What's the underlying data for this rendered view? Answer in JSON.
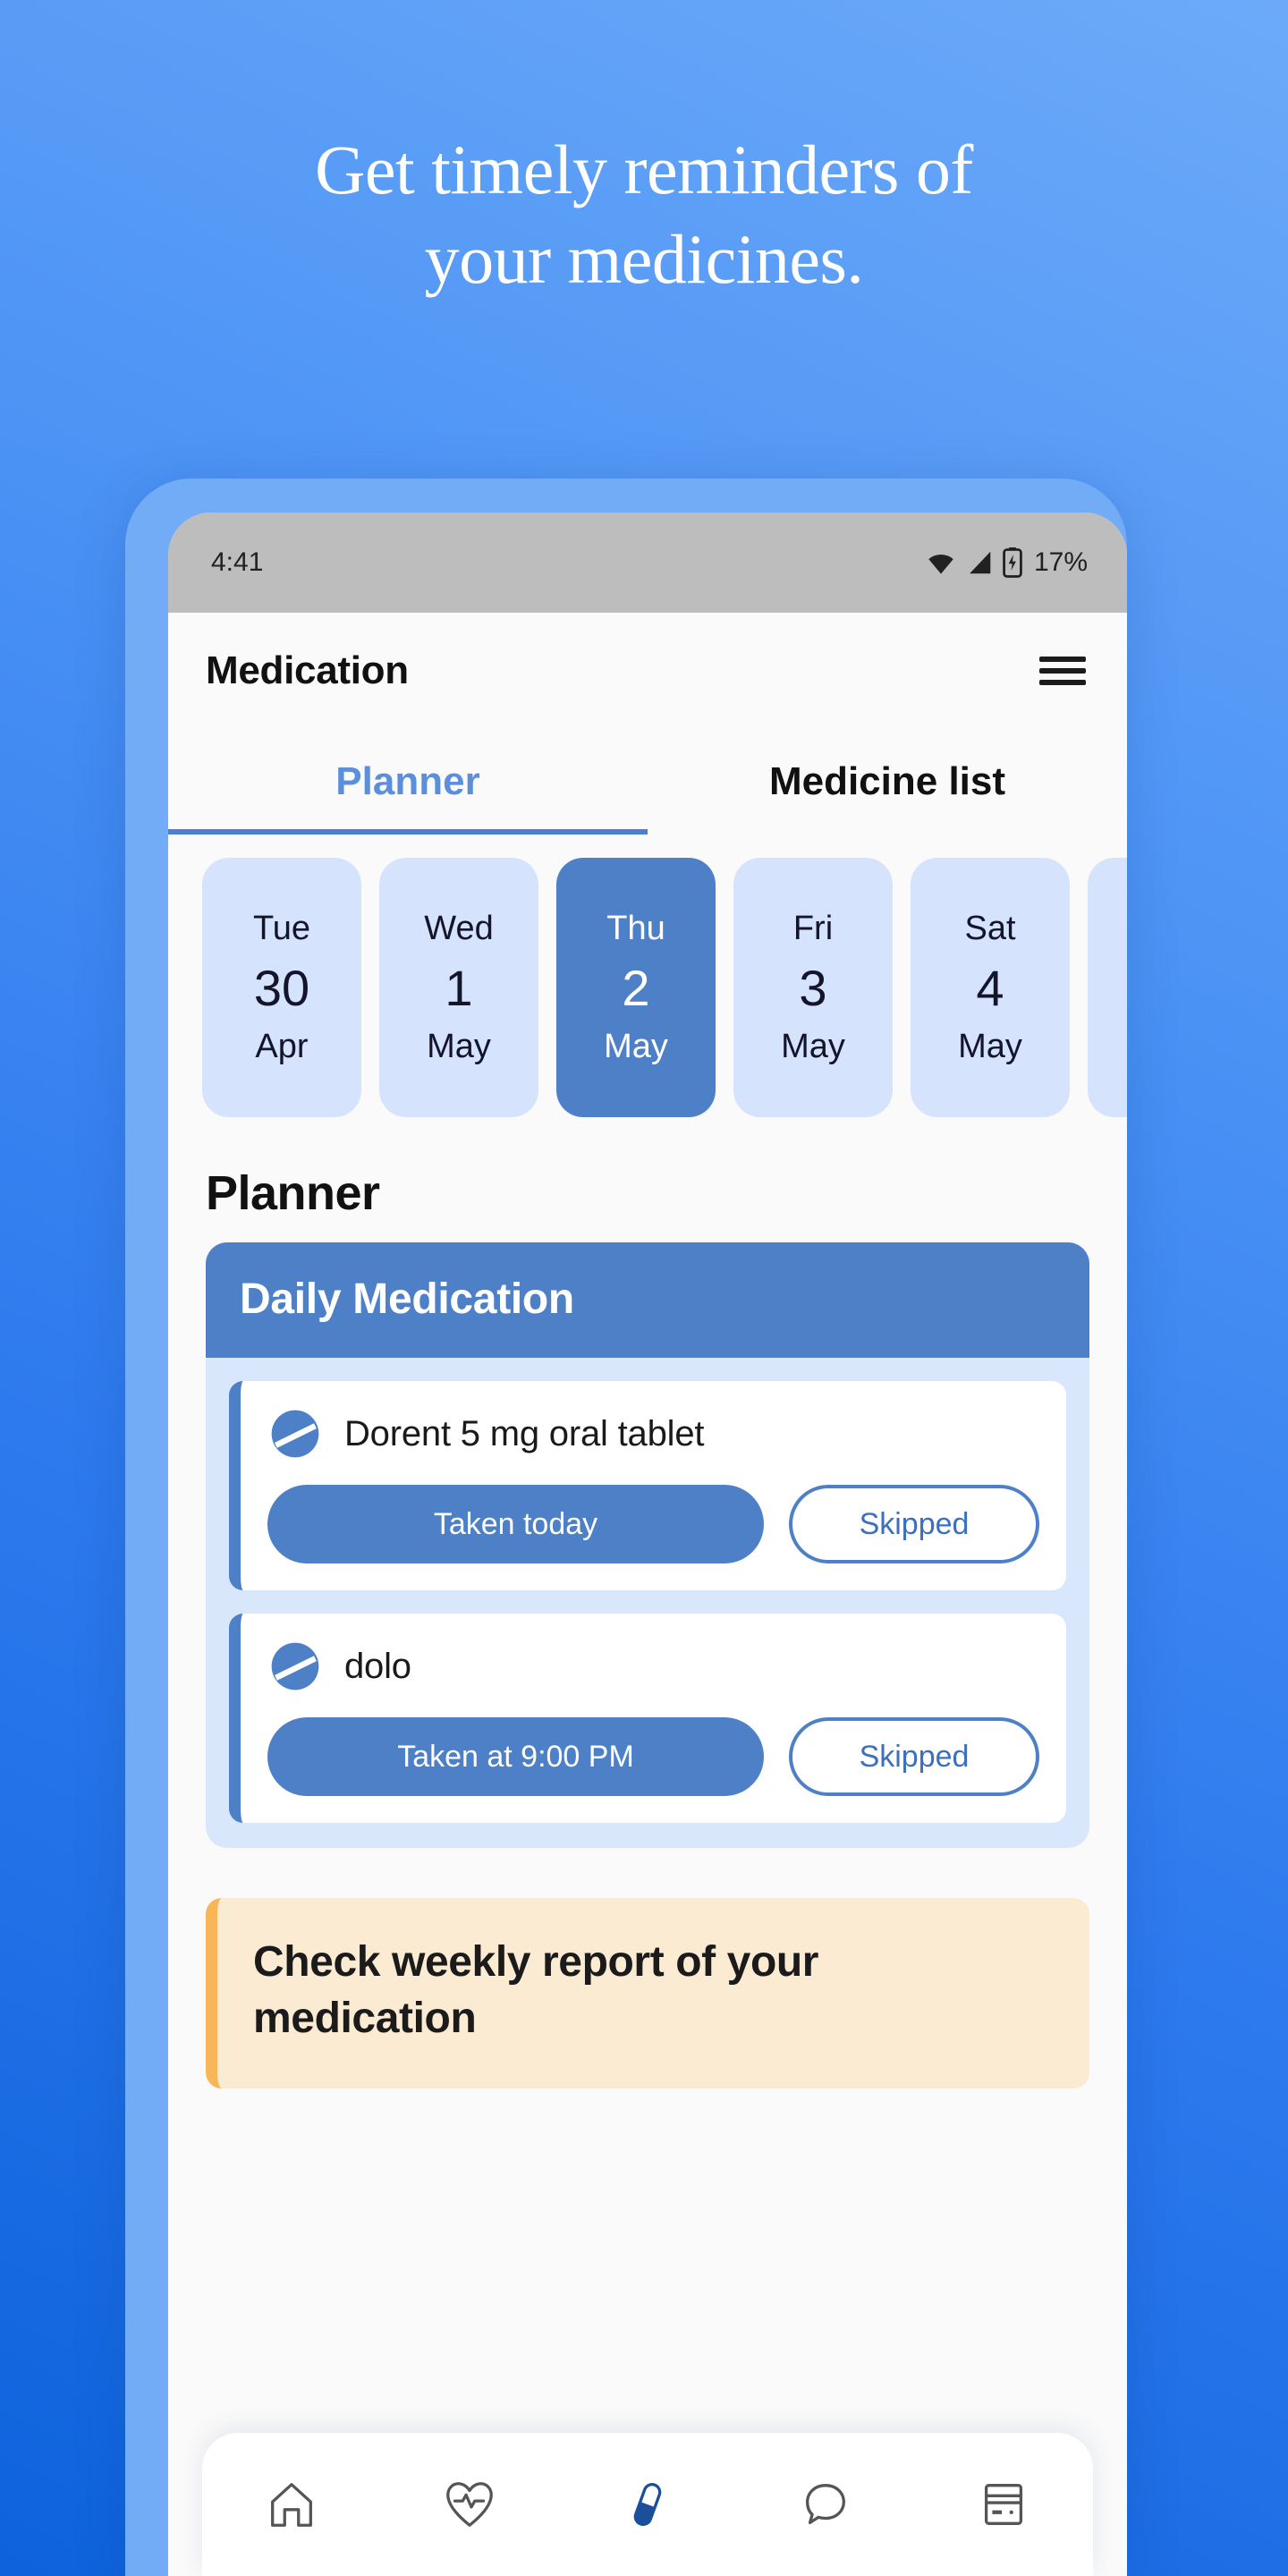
{
  "hero": {
    "line1": "Get timely reminders of",
    "line2": "your medicines."
  },
  "colors": {
    "bg_top_right": "#6CAAF9",
    "bg_bottom_left": "#0E62DC",
    "phone_bezel": "#72ACF7",
    "accent_blue": "#4E80C8",
    "tab_active_blue": "#5C8FDB",
    "chip_light_blue": "#D5E4FC",
    "card_body_blue": "#D9E7FD",
    "banner_cream": "#FBEBD3",
    "banner_accent_orange": "#F7B759",
    "status_bar_gray": "#BDBDBD",
    "screen_bg": "#FAFAFA"
  },
  "status_bar": {
    "time": "4:41",
    "battery_percent": "17%",
    "icons": [
      "wifi-icon",
      "cellular-signal-icon",
      "battery-charging-icon"
    ]
  },
  "app_bar": {
    "title": "Medication",
    "menu_icon": "hamburger-menu-icon"
  },
  "tabs": [
    {
      "label": "Planner",
      "active": true
    },
    {
      "label": "Medicine list",
      "active": false
    }
  ],
  "date_strip": [
    {
      "dow": "Tue",
      "num": "30",
      "mon": "Apr",
      "selected": false
    },
    {
      "dow": "Wed",
      "num": "1",
      "mon": "May",
      "selected": false
    },
    {
      "dow": "Thu",
      "num": "2",
      "mon": "May",
      "selected": true
    },
    {
      "dow": "Fri",
      "num": "3",
      "mon": "May",
      "selected": false
    },
    {
      "dow": "Sat",
      "num": "4",
      "mon": "May",
      "selected": false
    },
    {
      "dow": "",
      "num": "",
      "mon": "",
      "selected": false
    }
  ],
  "section": {
    "title": "Planner"
  },
  "med_card": {
    "header": "Daily Medication",
    "items": [
      {
        "icon": "pill-icon",
        "name": "Dorent 5 mg oral tablet",
        "taken_label": "Taken today",
        "skipped_label": "Skipped"
      },
      {
        "icon": "pill-icon",
        "name": "dolo",
        "taken_label": "Taken at 9:00 PM",
        "skipped_label": "Skipped"
      }
    ]
  },
  "report_banner": {
    "text": "Check weekly report of your medication"
  },
  "bottom_nav": [
    {
      "icon": "home-icon",
      "active": false
    },
    {
      "icon": "heart-pulse-icon",
      "active": false
    },
    {
      "icon": "pill-capsule-icon",
      "active": true
    },
    {
      "icon": "chat-bubble-icon",
      "active": false
    },
    {
      "icon": "card-icon",
      "active": false
    }
  ]
}
